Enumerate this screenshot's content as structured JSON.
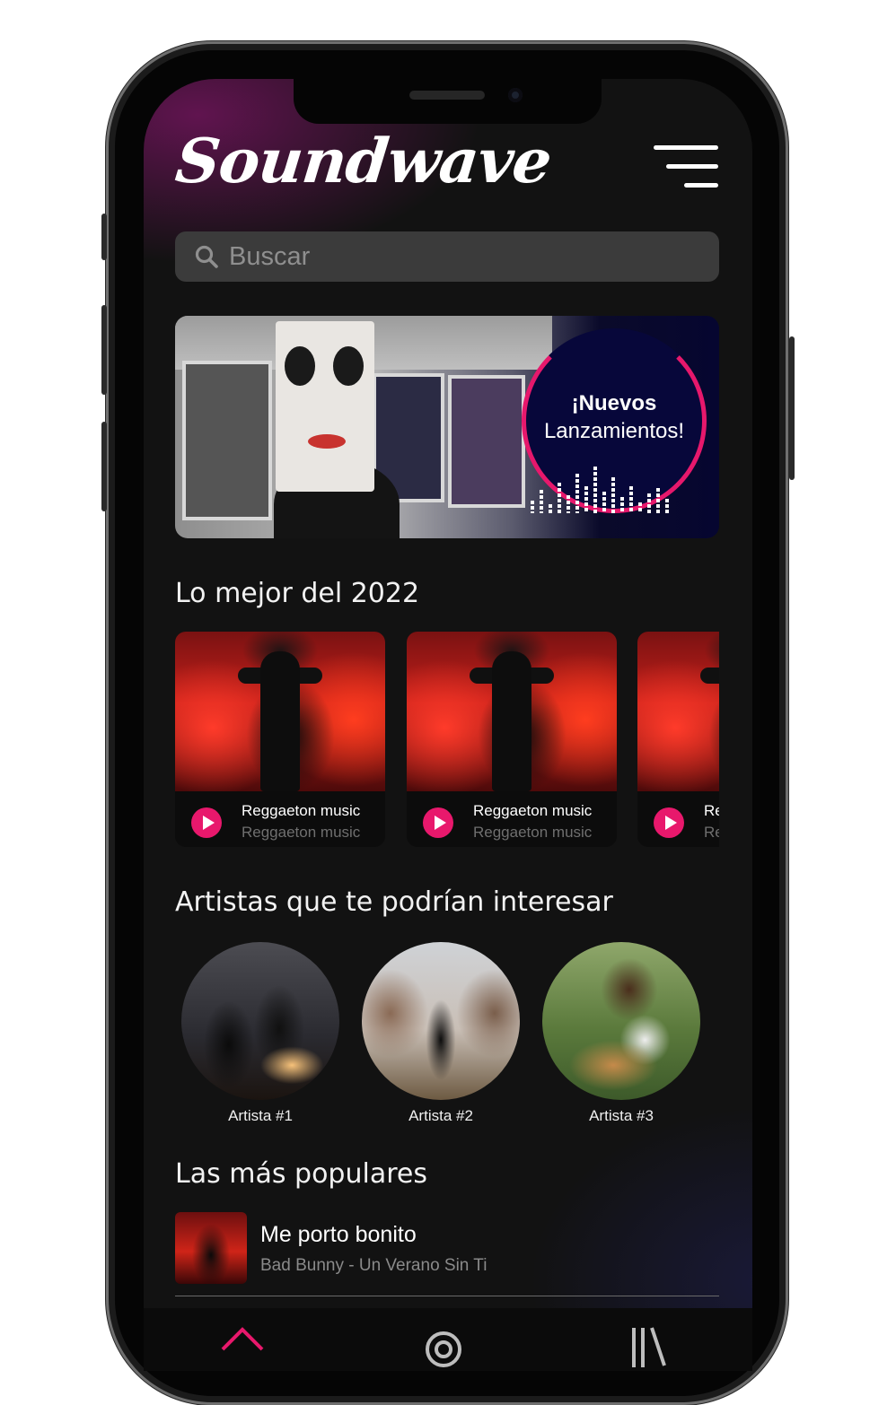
{
  "app": {
    "name": "Soundwave"
  },
  "search": {
    "placeholder": "Buscar",
    "value": ""
  },
  "banner": {
    "title_line1": "¡Nuevos",
    "title_line2": "Lanzamientos!"
  },
  "best_2022": {
    "heading": "Lo mejor del 2022",
    "cards": [
      {
        "title": "Reggaeton music",
        "subtitle": "Reggaeton music"
      },
      {
        "title": "Reggaeton music",
        "subtitle": "Reggaeton music"
      },
      {
        "title": "Reggaeton music",
        "subtitle": "Reggaeton music"
      }
    ]
  },
  "artists": {
    "heading": "Artistas que te podrían interesar",
    "items": [
      {
        "name": "Artista #1"
      },
      {
        "name": "Artista #2"
      },
      {
        "name": "Artista #3"
      }
    ]
  },
  "popular": {
    "heading": "Las más populares",
    "items": [
      {
        "title": "Me porto bonito",
        "subtitle": "Bad Bunny - Un Verano Sin Ti"
      }
    ]
  },
  "nav": {
    "items": [
      {
        "icon": "home-icon"
      },
      {
        "icon": "radio-icon"
      },
      {
        "icon": "library-icon"
      }
    ]
  },
  "colors": {
    "accent": "#e8186c",
    "background": "#121212",
    "surface": "#3b3b3b"
  }
}
